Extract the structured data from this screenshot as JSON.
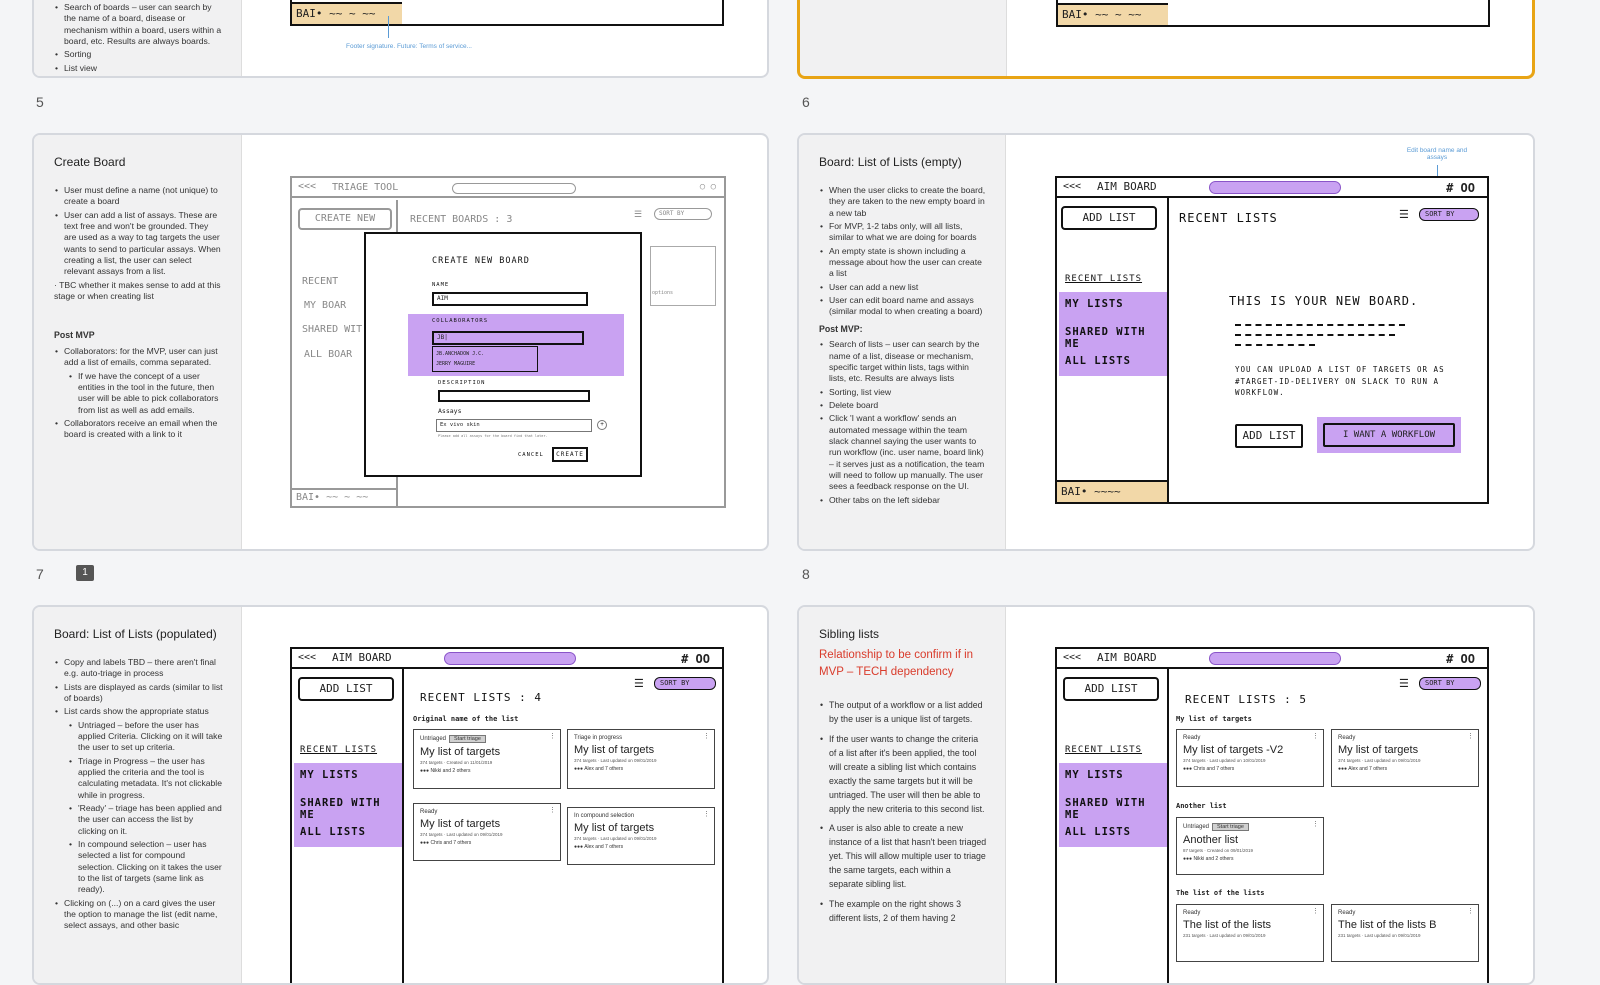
{
  "top_left": {
    "notes": [
      "Search of boards – user can search by the name of a board, disease or mechanism within a board, users within a board, etc. Results are always boards.",
      "Sorting",
      "List view"
    ],
    "footer_text": "BAI• ~~ ~ ~~",
    "annotation": "Footer signature. Future: Terms of service..."
  },
  "top_right": {
    "footer_text": "BAI• ~~ ~ ~~"
  },
  "slides": [
    {
      "number": "5"
    },
    {
      "number": "6"
    },
    {
      "number": "7",
      "comment_count": "1"
    },
    {
      "number": "8"
    }
  ],
  "slide5": {
    "title": "Create Board",
    "bullets": [
      "User must define a name (not unique) to create a board",
      "User can add a list of assays. These are text free and won't be grounded. They are used as a way to tag targets the user wants to send to particular assays. When creating a list, the user can select relevant assays from a list."
    ],
    "tbc": "· TBC whether it makes sense to add at this stage or when creating list",
    "post_mvp_heading": "Post MVP",
    "post_mvp": [
      "Collaborators: for the MVP, user can just add a list of emails, comma separated."
    ],
    "post_mvp_sub": "If we have the concept of a user entities in the tool in the future, then user will be able to pick collaborators from list as well as add emails.",
    "post_mvp_last": "Collaborators receive an email when the board is created with a link to it",
    "wf": {
      "brand": "TRIAGE TOOL",
      "create_new": "CREATE NEW",
      "recent_boards": "RECENT BOARDS :",
      "recent_count": "3",
      "sort_by": "SORT BY",
      "side_items": [
        "RECENT",
        "MY BOAR",
        "SHARED WIT",
        "ALL BOAR"
      ],
      "modal_title": "CREATE NEW BOARD",
      "name_label": "NAME",
      "name_value": "AIM",
      "collab_label": "COLLABORATORS",
      "collab_value": "JB|",
      "collab_options": [
        "JB.ANCHADOW J.C.",
        "JERRY MAGUIRE"
      ],
      "desc_label": "DESCRIPTION",
      "assays_label": "Assays",
      "assays_value": "Ex vivo skin",
      "assays_help": "Please add all assays for the board find that later.",
      "cancel": "CANCEL",
      "create": "CREATE",
      "right_text": "options",
      "footer_text": "BAI• ~~ ~ ~~"
    }
  },
  "slide6": {
    "title": "Board: List of Lists (empty)",
    "bullets": [
      "When the user clicks to create the board, they are taken to the new empty board in a new tab",
      "For MVP, 1-2 tabs only, will all lists, similar to what we are doing for boards",
      "An empty state is shown including a message about how the user can create a list",
      "User can add a new list",
      "User can edit board name and assays (similar modal to when creating a board)"
    ],
    "post_mvp_heading": "Post MVP:",
    "post_mvp": [
      "Search of lists – user can search by the name of a list, disease or mechanism, specific target within lists, tags within lists, etc. Results are always lists",
      "Sorting, list view",
      "Delete board",
      "Click 'I want a workflow' sends an automated message within the team slack channel saying the user wants to run workflow (inc. user name, board link) – it serves just as a notification, the team will need to follow up manually. The user sees a feedback response on the UI.",
      "Other tabs on the left sidebar"
    ],
    "annotation": "Edit board name and assays",
    "wf": {
      "brand": "AIM BOARD",
      "hash": "# OO",
      "add_list": "ADD LIST",
      "recent_lists": "RECENT LISTS",
      "sort_by": "SORT BY",
      "side_heading": "RECENT LISTS",
      "side_items": [
        "MY LISTS",
        "SHARED WITH ME",
        "ALL LISTS"
      ],
      "empty_title": "THIS IS YOUR NEW BOARD.",
      "empty_msg": "YOU CAN UPLOAD A LIST OF TARGETS OR AS #TARGET-ID-DELIVERY ON SLACK TO RUN A WORKFLOW.",
      "add_list_btn": "ADD LIST",
      "workflow_btn": "I WANT A WORKFLOW",
      "footer_text": "BAI• ~~~~"
    }
  },
  "slide7": {
    "title": "Board: List of Lists (populated)",
    "bullets": [
      "Copy and labels TBD – there aren't final e.g. auto-triage in process",
      "Lists are displayed as cards (similar to list of boards)",
      "List cards show the appropriate status"
    ],
    "sub_bullets": [
      "Untriaged – before the user has applied Criteria. Clicking on it will take the user to set up criteria.",
      "Triage in Progress – the user has applied the criteria and the tool is calculating metadata. It's not clickable while in progress.",
      "'Ready' – triage has been applied and the user can access the list by clicking on it.",
      "In compound selection – user has selected a list for compound selection. Clicking on it takes the user to the list of targets (same link as ready)."
    ],
    "last_bullet": "Clicking on (...) on a card gives the user the option to manage the list (edit name, select assays, and other basic",
    "wf": {
      "brand": "AIM BOARD",
      "hash": "# OO",
      "add_list": "ADD LIST",
      "recent_lists": "RECENT LISTS :",
      "recent_count": "4",
      "sort_by": "SORT BY",
      "side_heading": "RECENT LISTS",
      "side_items": [
        "MY LISTS",
        "SHARED WITH ME",
        "ALL LISTS"
      ],
      "section_title": "Original name of the list",
      "cards": [
        {
          "status": "Untriaged",
          "tag": "Start triage",
          "title": "My list of targets",
          "meta": "374 targets · Created on 11/01/2019",
          "people": "Nikki and 2 others"
        },
        {
          "status": "Triage in progress",
          "title": "My list of targets",
          "meta": "374 targets · Last updated on 09/01/2019",
          "people": "Alex and 7 others"
        },
        {
          "status": "Ready",
          "title": "My list of targets",
          "meta": "374 targets · Last updated on 09/01/2019",
          "people": "Chris and 7 others"
        },
        {
          "status": "In compound selection",
          "title": "My list of targets",
          "meta": "374 targets · Last updated on 09/01/2019",
          "people": "Alex and 7 others"
        }
      ]
    }
  },
  "slide8": {
    "title": "Sibling lists",
    "warning": "Relationship to be confirm if in MVP – TECH dependency",
    "bullets": [
      "The output of a workflow or a list added by the user is a unique list of targets.",
      "If the user wants to change the criteria of a list after it's been applied, the tool will create a sibling list which contains exactly the same targets but it will be untriaged. The user will then be able to apply the new criteria to this second list.",
      "A user is also able to create a new instance of a list that hasn't been triaged yet. This will allow multiple user to triage the same targets, each within a separate sibling list.",
      "The example on the right shows 3 different lists, 2 of them having 2"
    ],
    "wf": {
      "brand": "AIM BOARD",
      "hash": "# OO",
      "add_list": "ADD LIST",
      "recent_lists": "RECENT LISTS :",
      "recent_count": "5",
      "sort_by": "SORT BY",
      "side_heading": "RECENT LISTS",
      "side_items": [
        "MY LISTS",
        "SHARED WITH ME",
        "ALL LISTS"
      ],
      "sections": [
        "My list of targets",
        "Another list",
        "The list of the lists"
      ],
      "cards": [
        {
          "status": "Ready",
          "title": "My list of targets -V2",
          "meta": "374 targets · Last updated on 10/01/2019",
          "people": "Chris and 7 others"
        },
        {
          "status": "Ready",
          "title": "My list of targets",
          "meta": "374 targets · Last updated on 09/01/2019",
          "people": "Alex and 7 others"
        },
        {
          "status": "Untriaged",
          "tag": "Start triage",
          "title": "Another list",
          "meta": "87 targets · Created on 09/01/2019",
          "people": "Nikki and 2 others"
        },
        {
          "status": "Ready",
          "title": "The list of the lists",
          "meta": "231 targets · Last updated on 09/01/2019",
          "people": ""
        },
        {
          "status": "Ready",
          "title": "The list of the lists B",
          "meta": "231 targets · Last updated on 09/01/2019",
          "people": ""
        }
      ]
    }
  }
}
